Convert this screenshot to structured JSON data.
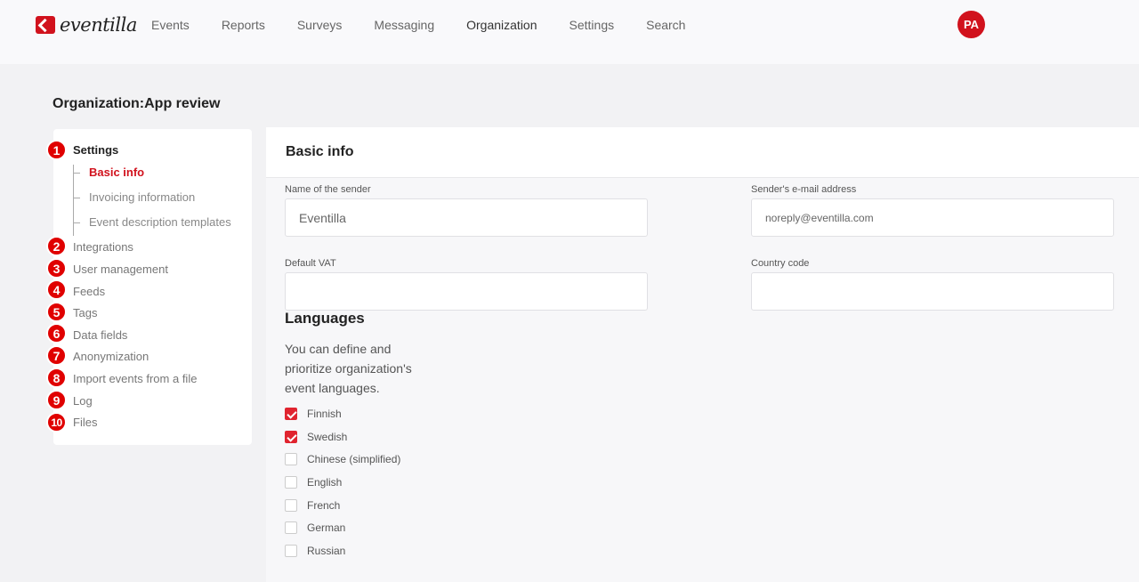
{
  "brand": {
    "name": "eventilla",
    "color": "#d1121d"
  },
  "nav": [
    {
      "label": "Events"
    },
    {
      "label": "Reports"
    },
    {
      "label": "Surveys"
    },
    {
      "label": "Messaging"
    },
    {
      "label": "Organization"
    },
    {
      "label": "Settings"
    },
    {
      "label": "Search"
    }
  ],
  "user": {
    "initials": "PA"
  },
  "page": {
    "title": "Organization:App review"
  },
  "sidebar": {
    "heading": "Settings",
    "sub_items": [
      {
        "label": "Basic info"
      },
      {
        "label": "Invoicing information"
      },
      {
        "label": "Event description templates"
      }
    ],
    "items": [
      {
        "label": "Integrations"
      },
      {
        "label": "User management"
      },
      {
        "label": "Feeds"
      },
      {
        "label": "Tags"
      },
      {
        "label": "Data fields"
      },
      {
        "label": "Anonymization"
      },
      {
        "label": "Import events from a file"
      },
      {
        "label": "Log"
      },
      {
        "label": "Files"
      }
    ],
    "badges": [
      "1",
      "2",
      "3",
      "4",
      "5",
      "6",
      "7",
      "8",
      "9",
      "10"
    ]
  },
  "main": {
    "title": "Basic info",
    "fields": {
      "sender_name": {
        "label": "Name of the sender",
        "value": "Eventilla"
      },
      "sender_email": {
        "label": "Sender's e-mail address",
        "value": "noreply@eventilla.com"
      },
      "default_vat": {
        "label": "Default VAT",
        "value": ""
      },
      "country_code": {
        "label": "Country code",
        "value": ""
      }
    },
    "languages": {
      "title": "Languages",
      "description": "You can define and prioritize organization's event languages.",
      "options": [
        {
          "label": "Finnish",
          "checked": true
        },
        {
          "label": "Swedish",
          "checked": true
        },
        {
          "label": "Chinese (simplified)",
          "checked": false
        },
        {
          "label": "English",
          "checked": false
        },
        {
          "label": "French",
          "checked": false
        },
        {
          "label": "German",
          "checked": false
        },
        {
          "label": "Russian",
          "checked": false
        }
      ]
    }
  }
}
